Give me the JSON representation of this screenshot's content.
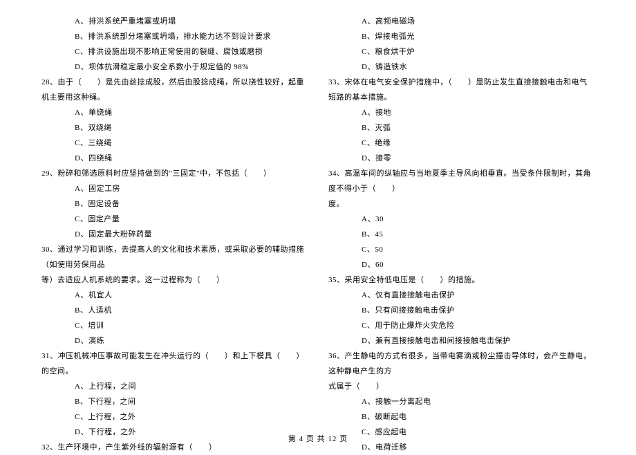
{
  "left_column": {
    "options_27": {
      "a": "A、排洪系统严重堵塞或坍塌",
      "b": "B、排洪系统部分堵塞或坍塌，排水能力达不到设计要求",
      "c": "C、排洪设施出现不影响正常使用的裂缝、腐蚀或磨损",
      "d": "D、坝体抗滑稳定最小安全系数小于规定值的 98%"
    },
    "q28": "28、由于（　　）是先由丝捻成股，然后由股捻成绳，所以挠性较好，起重机主要用这种绳。",
    "options_28": {
      "a": "A、单绕绳",
      "b": "B、双绕绳",
      "c": "C、三绕绳",
      "d": "D、四绕绳"
    },
    "q29": "29、粉碎和筛选原料时应坚持做到的\"三固定\"中，不包括（　　）",
    "options_29": {
      "a": "A、固定工房",
      "b": "B、固定设备",
      "c": "C、固定产量",
      "d": "D、固定最大粉碎药量"
    },
    "q30": "30、通过学习和训练，去提高人的文化和技术素质，或采取必要的辅助措施（如使用劳保用品",
    "q30_cont": "等）去适应人机系统的要求。这一过程称为（　　）",
    "options_30": {
      "a": "A、机宜人",
      "b": "B、人适机",
      "c": "C、培训",
      "d": "D、演练"
    },
    "q31": "31、冲压机械冲压事故可能发生在冲头运行的（　　）和上下模具（　　）的空间。",
    "options_31": {
      "a": "A、上行程，之间",
      "b": "B、下行程，之间",
      "c": "C、上行程，之外",
      "d": "D、下行程，之外"
    },
    "q32": "32、生产环境中，产生紫外线的辐射源有（　　）"
  },
  "right_column": {
    "options_32": {
      "a": "A、高频电磁场",
      "b": "B、焊接电弧光",
      "c": "C、粮食烘干炉",
      "d": "D、铸造铁水"
    },
    "q33": "33、宋体在电气安全保护措施中，（　　）是防止发生直接接触电击和电气短路的基本措施。",
    "options_33": {
      "a": "A、接地",
      "b": "B、灭弧",
      "c": "C、绝缘",
      "d": "D、接零"
    },
    "q34": "34、高温车间的纵轴应与当地夏季主导风向相垂直。当受条件限制时，其角度不得小于（　　）",
    "q34_cont": "度。",
    "options_34": {
      "a": "A、30",
      "b": "B、45",
      "c": "C、50",
      "d": "D、60"
    },
    "q35": "35、采用安全特低电压是（　　）的措施。",
    "options_35": {
      "a": "A、仅有直接接触电击保护",
      "b": "B、只有间接接触电击保护",
      "c": "C、用于防止爆炸火灾危险",
      "d": "D、兼有直接接触电击和间接接触电击保护"
    },
    "q36": "36、产生静电的方式有很多，当带电雾滴或粉尘撞击导体时，会产生静电，这种静电产生的方",
    "q36_cont": "式属于（　　）",
    "options_36": {
      "a": "A、接触一分离起电",
      "b": "B、破断起电",
      "c": "C、感应起电",
      "d": "D、电荷迁移"
    }
  },
  "footer": "第 4 页 共 12 页"
}
